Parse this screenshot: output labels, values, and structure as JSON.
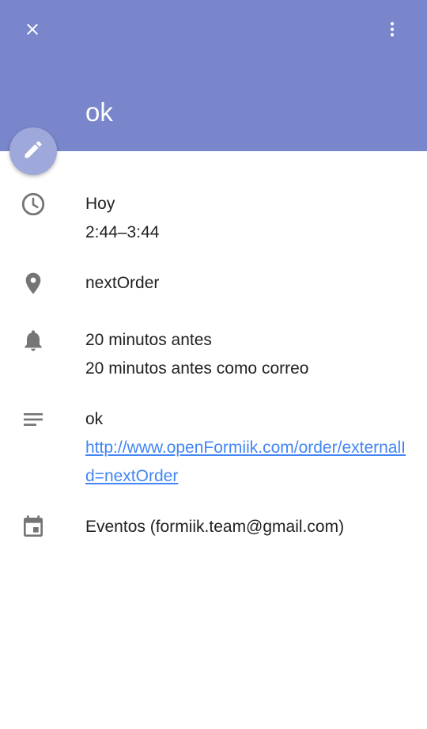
{
  "header": {
    "title": "ok",
    "background_color": "#7986cb",
    "close_icon": "close-icon",
    "more_icon": "more-vert-icon"
  },
  "fab": {
    "icon": "pencil-icon",
    "color": "#9fa8da"
  },
  "details": {
    "time": {
      "icon": "clock-icon",
      "day": "Hoy",
      "range": "2:44–3:44"
    },
    "location": {
      "icon": "place-icon",
      "text": "nextOrder"
    },
    "reminders": {
      "icon": "bell-icon",
      "items": [
        "20 minutos antes",
        "20 minutos antes como correo"
      ]
    },
    "description": {
      "icon": "notes-icon",
      "text": "ok",
      "link": "http://www.openFormiik.com/order/externalId=nextOrder",
      "link_color": "#4285f4"
    },
    "calendar": {
      "icon": "calendar-icon",
      "text": "Eventos (formiik.team@gmail.com)"
    }
  }
}
